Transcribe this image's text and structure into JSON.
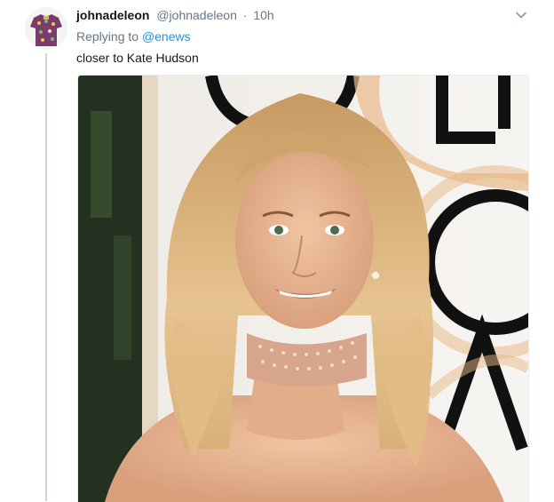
{
  "tweet": {
    "display_name": "johnadeleon",
    "handle": "@johnadeleon",
    "separator": "·",
    "time": "10h",
    "reply_prefix": "Replying to",
    "reply_mention": "@enews",
    "text": "closer to Kate Hudson",
    "avatar_icon": "shirt-icon",
    "menu_icon": "chevron-down-icon",
    "photo_backdrop_lettering": [
      "G",
      "L",
      "O"
    ]
  },
  "colors": {
    "name": "#14171a",
    "secondary": "#657786",
    "link": "#1b95e0",
    "thread_line": "#c9d4dc",
    "backdrop_gold": "#e8b98a"
  }
}
